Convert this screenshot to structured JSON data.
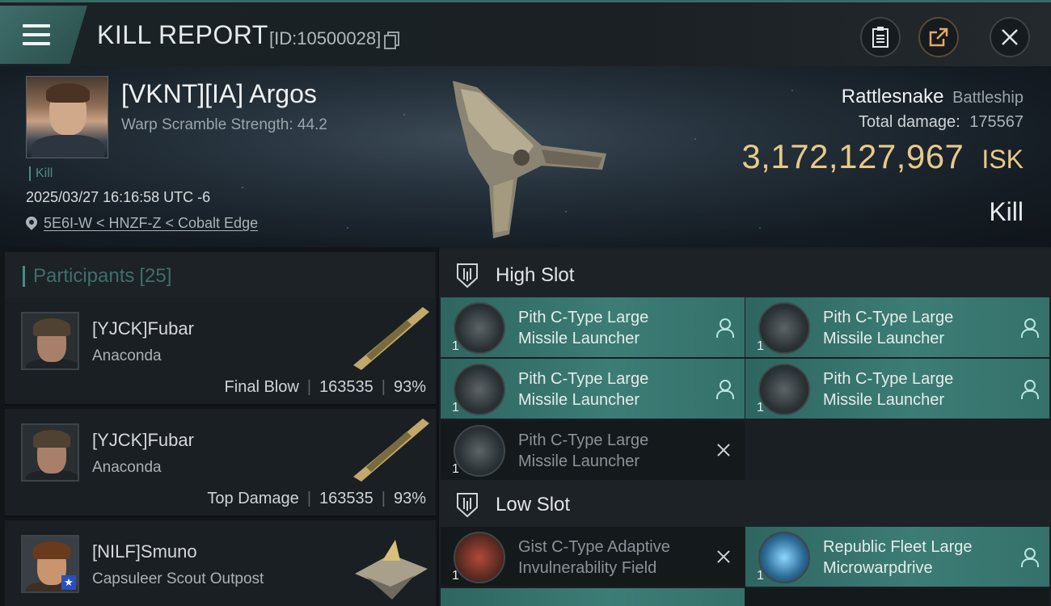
{
  "header": {
    "title": "KILL REPORT",
    "report_id": "[ID:10500028]"
  },
  "victim": {
    "name": "[VKNT][IA] Argos",
    "warp_scramble": "Warp Scramble Strength: 44.2",
    "tag": "Kill",
    "datetime": "2025/03/27 16:16:58 UTC -6",
    "location": "5E6I-W < HNZF-Z < Cobalt Edge",
    "ship": "Rattlesnake",
    "ship_class": "Battleship",
    "total_damage_label": "Total damage:",
    "total_damage": "175567",
    "isk_value": "3,172,127,967",
    "isk_unit": "ISK",
    "result": "Kill"
  },
  "participants": {
    "label": "Participants",
    "count": "[25]",
    "rows": [
      {
        "name": "[YJCK]Fubar",
        "ship": "Anaconda",
        "role": "Final Blow",
        "damage": "163535",
        "percent": "93%"
      },
      {
        "name": "[YJCK]Fubar",
        "ship": "Anaconda",
        "role": "Top Damage",
        "damage": "163535",
        "percent": "93%"
      },
      {
        "name": "[NILF]Smuno",
        "ship": "Capsuleer Scout Outpost",
        "role": "",
        "damage": "",
        "percent": ""
      }
    ]
  },
  "slots": {
    "high_label": "High Slot",
    "low_label": "Low Slot",
    "high": [
      {
        "line1": "Pith C-Type Large",
        "line2": "Missile Launcher",
        "qty": "1",
        "state": "fitted"
      },
      {
        "line1": "Pith C-Type Large",
        "line2": "Missile Launcher",
        "qty": "1",
        "state": "fitted"
      },
      {
        "line1": "Pith C-Type Large",
        "line2": "Missile Launcher",
        "qty": "1",
        "state": "fitted"
      },
      {
        "line1": "Pith C-Type Large",
        "line2": "Missile Launcher",
        "qty": "1",
        "state": "fitted"
      },
      {
        "line1": "Pith C-Type Large",
        "line2": "Missile Launcher",
        "qty": "1",
        "state": "destroyed"
      }
    ],
    "low": [
      {
        "line1": "Gist C-Type Adaptive",
        "line2": "Invulnerability Field",
        "qty": "1",
        "state": "destroyed"
      },
      {
        "line1": "Republic Fleet Large",
        "line2": "Microwarpdrive",
        "qty": "1",
        "state": "fitted"
      }
    ]
  },
  "colors": {
    "accent": "#3c7d76",
    "isk": "#e9c988",
    "tag": "#4f8a84"
  }
}
